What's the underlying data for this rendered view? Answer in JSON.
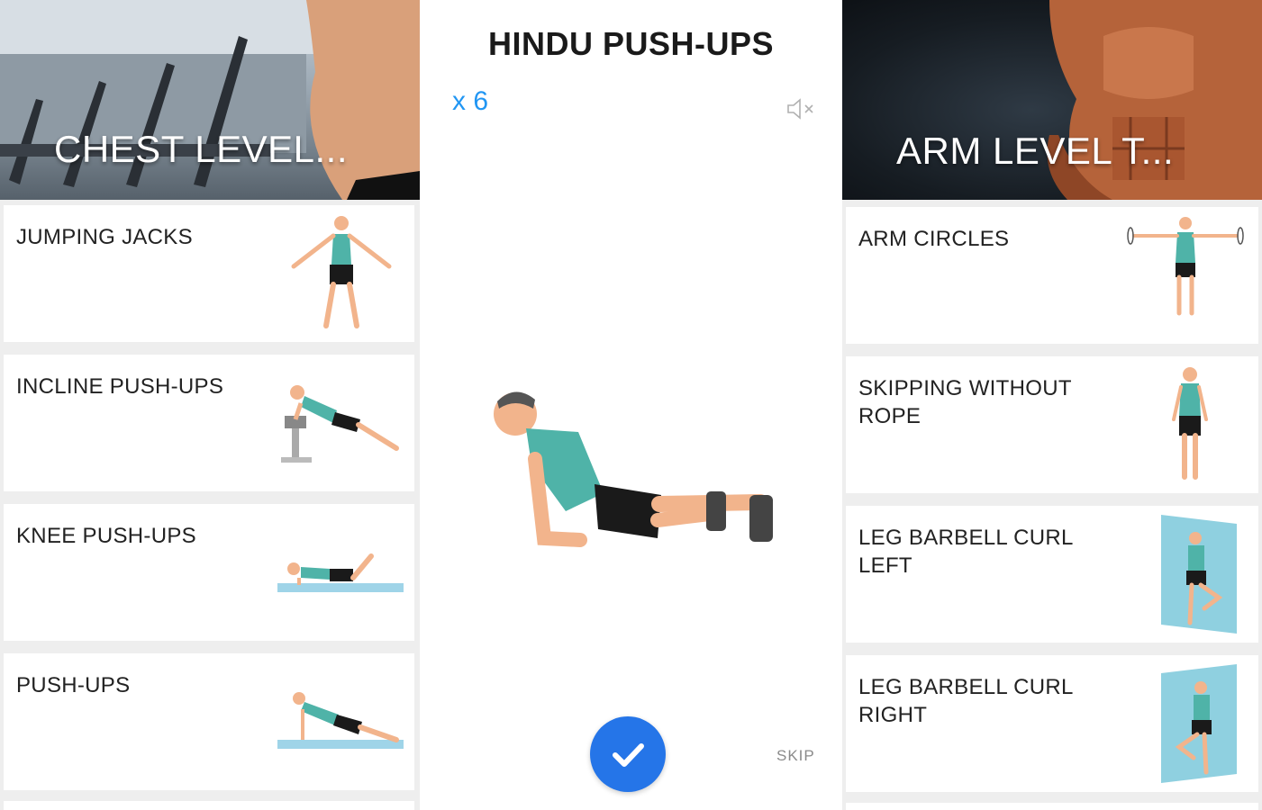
{
  "left_panel": {
    "title": "CHEST LEVEL...",
    "exercises": [
      {
        "label": "JUMPING JACKS"
      },
      {
        "label": "INCLINE PUSH-UPS"
      },
      {
        "label": "KNEE PUSH-UPS"
      },
      {
        "label": "PUSH-UPS"
      }
    ]
  },
  "center": {
    "title": "HINDU PUSH-UPS",
    "reps": "x 6",
    "skip_label": "SKIP",
    "icons": {
      "mute": "volume-mute-icon",
      "done": "checkmark-icon"
    },
    "accent_color": "#2196f3",
    "button_color": "#2575e8"
  },
  "right_panel": {
    "title": "ARM LEVEL T...",
    "exercises": [
      {
        "label": "ARM CIRCLES"
      },
      {
        "label": "SKIPPING WITHOUT ROPE"
      },
      {
        "label": "LEG BARBELL CURL LEFT"
      },
      {
        "label": "LEG BARBELL CURL RIGHT"
      }
    ]
  },
  "colors": {
    "shirt": "#4fb3a8",
    "skin": "#f2b48c",
    "shorts": "#1a1a1a"
  }
}
